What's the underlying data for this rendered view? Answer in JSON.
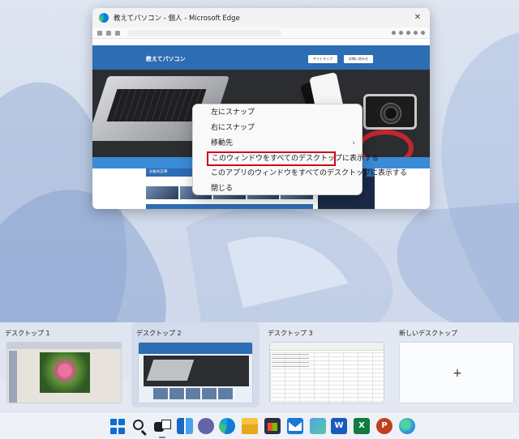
{
  "window": {
    "title": "教えてパソコン - 個人 - Microsoft Edge",
    "site_name": "教えてパソコン",
    "site_buttons": [
      "サイトマップ",
      "お問い合わせ"
    ],
    "section_heading": "お勧め記事"
  },
  "context_menu": {
    "items": [
      {
        "label": "左にスナップ",
        "submenu": false,
        "highlighted": false
      },
      {
        "label": "右にスナップ",
        "submenu": false,
        "highlighted": false
      },
      {
        "label": "移動先",
        "submenu": true,
        "highlighted": false
      },
      {
        "label": "このウィンドウをすべてのデスクトップに表示する",
        "submenu": false,
        "highlighted": true
      },
      {
        "label": "このアプリのウィンドウをすべてのデスクトップに表示する",
        "submenu": false,
        "highlighted": false
      },
      {
        "label": "閉じる",
        "submenu": false,
        "highlighted": false
      }
    ],
    "chevron": "›",
    "highlight_color": "#d0021b"
  },
  "desktops": [
    {
      "label": "デスクトップ 1",
      "active": false
    },
    {
      "label": "デスクトップ 2",
      "active": true
    },
    {
      "label": "デスクトップ 3",
      "active": false
    }
  ],
  "new_desktop": {
    "label": "新しいデスクトップ",
    "icon": "+"
  },
  "taskbar": {
    "icons": [
      "start-icon",
      "search-icon",
      "task-view-icon",
      "widgets-icon",
      "teams-chat-icon",
      "edge-icon",
      "file-explorer-icon",
      "store-icon",
      "mail-icon",
      "photos-icon",
      "word-icon",
      "excel-icon",
      "powerpoint-icon",
      "globe-icon"
    ],
    "letters": {
      "word": "W",
      "excel": "X",
      "powerpoint": "P"
    }
  }
}
